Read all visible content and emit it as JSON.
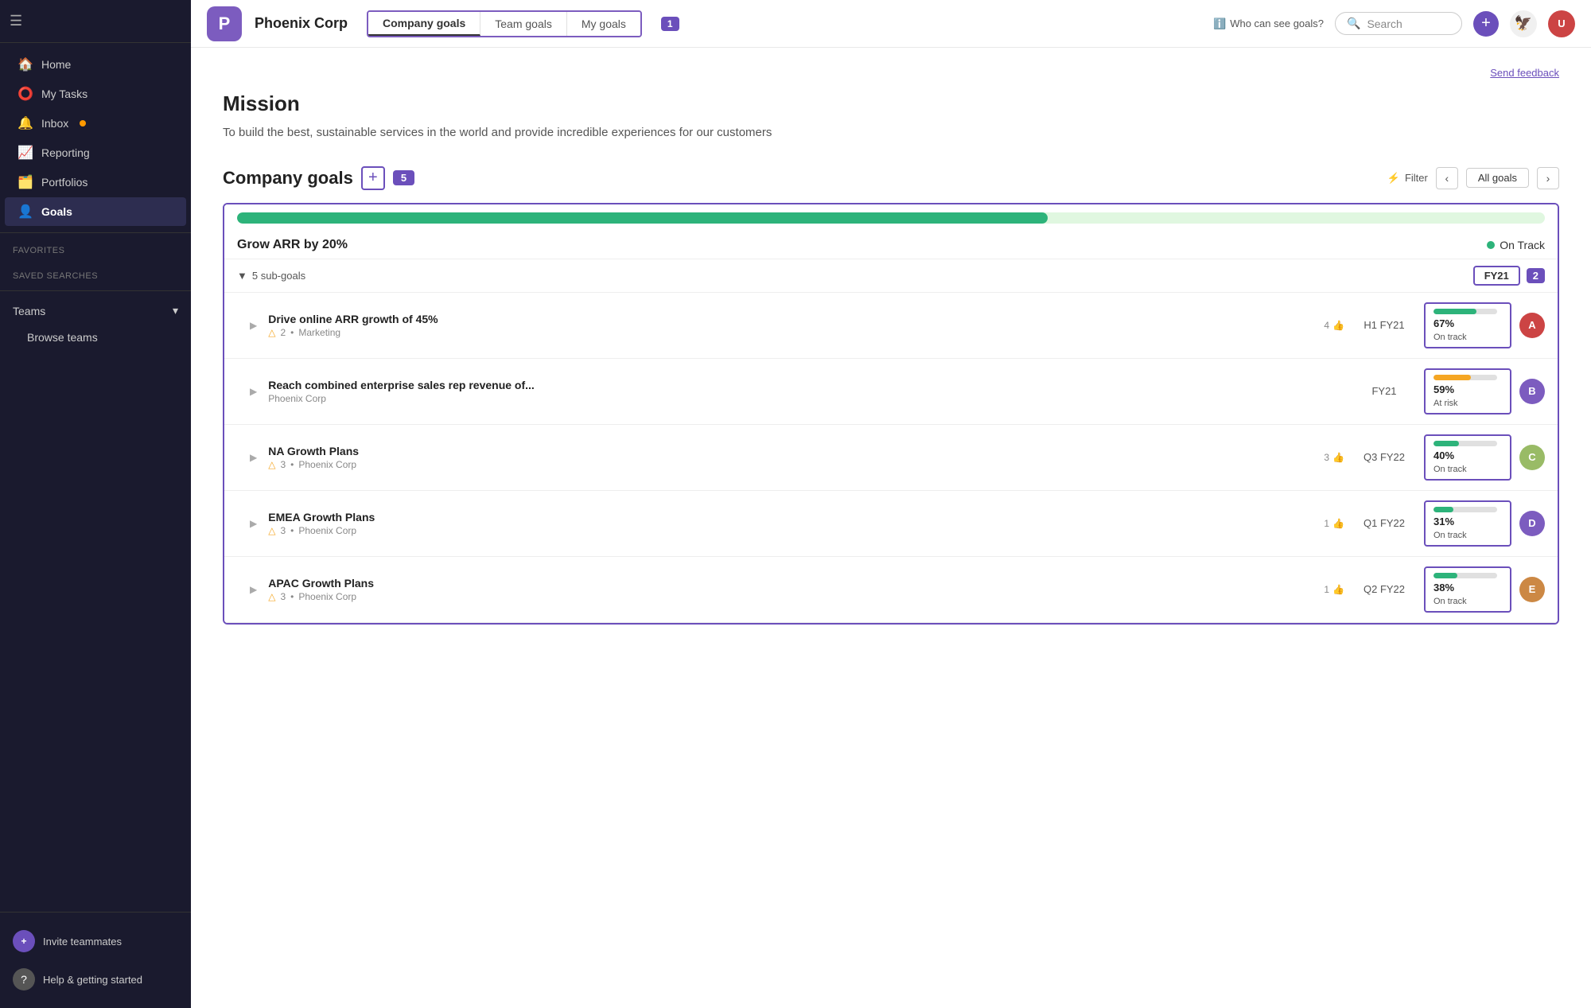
{
  "sidebar": {
    "nav_items": [
      {
        "id": "home",
        "label": "Home",
        "icon": "🏠",
        "active": false
      },
      {
        "id": "my-tasks",
        "label": "My Tasks",
        "icon": "⭕",
        "active": false
      },
      {
        "id": "inbox",
        "label": "Inbox",
        "icon": "🔔",
        "active": false,
        "has_dot": true
      },
      {
        "id": "reporting",
        "label": "Reporting",
        "icon": "📈",
        "active": false
      },
      {
        "id": "portfolios",
        "label": "Portfolios",
        "icon": "🗂️",
        "active": false
      },
      {
        "id": "goals",
        "label": "Goals",
        "icon": "👤",
        "active": true
      }
    ],
    "sections": {
      "favorites": "Favorites",
      "saved_searches": "Saved searches",
      "teams": "Teams",
      "browse_teams": "Browse teams"
    },
    "bottom": {
      "invite_label": "Invite teammates",
      "help_label": "Help & getting started"
    }
  },
  "header": {
    "company_name": "Phoenix Corp",
    "logo_letter": "P",
    "tabs": [
      {
        "id": "company",
        "label": "Company goals",
        "active": true
      },
      {
        "id": "team",
        "label": "Team goals",
        "active": false
      },
      {
        "id": "my",
        "label": "My goals",
        "active": false
      }
    ],
    "badge_num": "1",
    "who_can_see": "Who can see goals?",
    "search_placeholder": "Search",
    "add_tooltip": "Add"
  },
  "content": {
    "send_feedback": "Send feedback",
    "mission_title": "Mission",
    "mission_text": "To build the best, sustainable services in the world and provide incredible experiences for our customers",
    "goals_section": {
      "title": "Company goals",
      "count": "5",
      "filter_label": "Filter",
      "period_label": "All goals"
    },
    "main_goal": {
      "name": "Grow ARR by 20%",
      "progress_pct": 62,
      "status": "On Track",
      "subgoals_label": "5 sub-goals",
      "fy_label": "FY21",
      "badge_num": "2"
    },
    "subgoals": [
      {
        "name": "Drive online ARR growth of 45%",
        "likes": "4",
        "warnings": "2",
        "tag": "Marketing",
        "period": "H1 FY21",
        "pct": "67%",
        "status": "On track",
        "color": "green",
        "avatar_bg": "#c44"
      },
      {
        "name": "Reach combined enterprise sales rep revenue of...",
        "likes": "",
        "warnings": "",
        "tag": "Phoenix Corp",
        "period": "FY21",
        "pct": "59%",
        "status": "At risk",
        "color": "yellow",
        "avatar_bg": "#7c5cbf"
      },
      {
        "name": "NA Growth Plans",
        "likes": "3",
        "warnings": "3",
        "tag": "Phoenix Corp",
        "period": "Q3 FY22",
        "pct": "40%",
        "status": "On track",
        "color": "green",
        "avatar_bg": "#9b6"
      },
      {
        "name": "EMEA Growth Plans",
        "likes": "1",
        "warnings": "3",
        "tag": "Phoenix Corp",
        "period": "Q1 FY22",
        "pct": "31%",
        "status": "On track",
        "color": "green",
        "avatar_bg": "#7c5cbf"
      },
      {
        "name": "APAC Growth Plans",
        "likes": "1",
        "warnings": "3",
        "tag": "Phoenix Corp",
        "period": "Q2 FY22",
        "pct": "38%",
        "status": "On track",
        "color": "green",
        "avatar_bg": "#c84"
      }
    ]
  }
}
